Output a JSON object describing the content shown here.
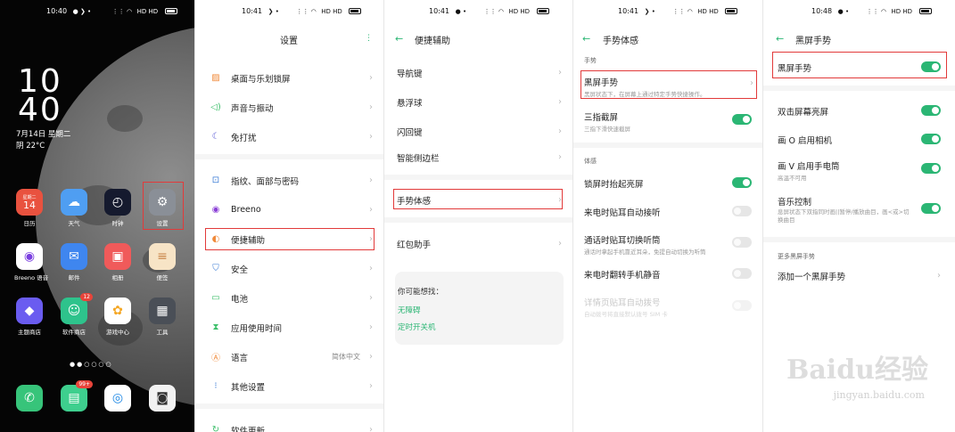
{
  "status": [
    {
      "time": "10:40"
    },
    {
      "time": "10:41"
    },
    {
      "time": "10:41"
    },
    {
      "time": "10:41"
    },
    {
      "time": "10:48"
    }
  ],
  "status_icons": "HD HD",
  "home": {
    "clock_hour": "10",
    "clock_min": "40",
    "date": "7月14日 星期二",
    "weather": "阴 22°C",
    "apps": [
      {
        "label": "日历",
        "top_text": "星期二",
        "num": "14"
      },
      {
        "label": "天气"
      },
      {
        "label": "时钟"
      },
      {
        "label": "设置"
      },
      {
        "label": "Breeno 语音"
      },
      {
        "label": "邮件"
      },
      {
        "label": "相册"
      },
      {
        "label": "便签"
      },
      {
        "label": "主题商店"
      },
      {
        "label": "软件商店",
        "badge": "12"
      },
      {
        "label": "游戏中心"
      },
      {
        "label": "工具"
      }
    ],
    "dock_badge": "99+"
  },
  "settings": {
    "title": "设置",
    "items": [
      {
        "label": "桌面与乐划锁屏"
      },
      {
        "label": "声音与振动"
      },
      {
        "label": "免打扰"
      },
      {
        "label": "指纹、面部与密码"
      },
      {
        "label": "Breeno"
      },
      {
        "label": "便捷辅助"
      },
      {
        "label": "安全"
      },
      {
        "label": "电池"
      },
      {
        "label": "应用使用时间"
      },
      {
        "label": "语言",
        "value": "简体中文"
      },
      {
        "label": "其他设置"
      },
      {
        "label": "软件更新"
      }
    ]
  },
  "assist": {
    "title": "便捷辅助",
    "items": [
      "导航键",
      "悬浮球",
      "闪回键",
      "智能侧边栏",
      "手势体感",
      "红包助手"
    ],
    "suggest_title": "你可能想找：",
    "suggest_links": [
      "无障碍",
      "定时开关机"
    ]
  },
  "gesture": {
    "title": "手势体感",
    "section1": "手势",
    "black_title": "黑屏手势",
    "black_desc": "黑屏状态下，在屏幕上通过特定手势快捷操作。",
    "three_title": "三指截屏",
    "three_desc": "三指下滑快速截屏",
    "section2": "体感",
    "items": [
      "锁屏时抬起亮屏",
      "来电时贴耳自动接听",
      "通话时贴耳切换听筒",
      "来电时翻转手机静音"
    ],
    "call_desc": "通话时拿起手机靠近耳朵，免提自动切换为听筒",
    "detail_title": "详情页贴耳自动拨号",
    "detail_desc": "自动拨号将直接默认拨号 SIM 卡"
  },
  "black": {
    "title": "黑屏手势",
    "master": "黑屏手势",
    "items": [
      "双击屏幕亮屏",
      "画 O 启用相机",
      "画 V 启用手电筒",
      "音乐控制"
    ],
    "v_desc": "高温不可用",
    "music_desc": "息屏状态下双指同时画||暂停/播放曲目，画<或>切换曲目",
    "more_section": "更多黑屏手势",
    "add": "添加一个黑屏手势"
  },
  "watermark": {
    "main": "Baidu经验",
    "sub": "jingyan.baidu.com"
  },
  "colors": {
    "accent": "#2bb674",
    "highlight": "#e23a3a"
  }
}
